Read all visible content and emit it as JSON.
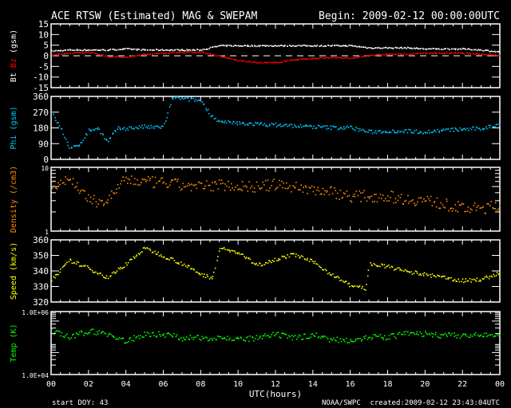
{
  "header": {
    "title": "ACE RTSW (Estimated) MAG & SWEPAM",
    "begin": "Begin: 2009-02-12 00:00:00UTC"
  },
  "footer": {
    "start_doy": "start DOY:  43",
    "agency": "NOAA/SWPC",
    "created": "created:2009-02-12 23:43:04UTC"
  },
  "colors": {
    "bt": "#ffffff",
    "bz": "#ff0000",
    "phi": "#00c8ff",
    "density": "#ff8c00",
    "speed": "#ffff00",
    "temp": "#00ff00",
    "axis": "#ffffff"
  },
  "chart_data": [
    {
      "type": "scatter",
      "name": "magnetic-field",
      "ylabel_parts": [
        "Bt",
        "Bz",
        "(gsm)"
      ],
      "ylim": [
        -15,
        15
      ],
      "yticks": [
        "15",
        "10",
        "5",
        "0",
        "-5",
        "-10",
        "-15"
      ],
      "ytick_values": [
        15,
        10,
        5,
        0,
        -5,
        -10,
        -15
      ],
      "dashed_zero": true,
      "x_hours": [
        0,
        1,
        2,
        3,
        4,
        5,
        6,
        7,
        8,
        9,
        10,
        11,
        12,
        13,
        14,
        15,
        16,
        17,
        18,
        19,
        20,
        21,
        22,
        23,
        24
      ],
      "series": [
        {
          "name": "Bt",
          "values": [
            2.5,
            3,
            3,
            3,
            3.5,
            3,
            3,
            3,
            3,
            5,
            5,
            5,
            5,
            5,
            5,
            5,
            5,
            4,
            4,
            4,
            3.5,
            3.5,
            3.5,
            3,
            2
          ]
        },
        {
          "name": "Bz",
          "values": [
            0.5,
            1.5,
            2,
            0,
            -0.5,
            1,
            1.5,
            2,
            2,
            0,
            -2,
            -3,
            -3,
            -1.5,
            -1,
            -0.5,
            -1,
            0.5,
            1,
            1,
            1.5,
            1.5,
            1.5,
            1,
            0.5
          ]
        }
      ]
    },
    {
      "type": "scatter",
      "name": "phi",
      "ylabel": "Phi (gsm)",
      "ylim": [
        0,
        360
      ],
      "yticks": [
        "360",
        "270",
        "180",
        "90",
        "0"
      ],
      "ytick_values": [
        360,
        270,
        180,
        90,
        0
      ],
      "x_hours": [
        0,
        0.5,
        1,
        1.5,
        2,
        2.5,
        3,
        3.5,
        4,
        4.5,
        5,
        5.5,
        6,
        6.5,
        7,
        7.5,
        8,
        8.5,
        9,
        10,
        11,
        12,
        13,
        14,
        15,
        16,
        17,
        18,
        19,
        20,
        21,
        22,
        23,
        24
      ],
      "series": [
        {
          "name": "Phi",
          "values": [
            270,
            180,
            60,
            90,
            170,
            180,
            100,
            180,
            180,
            185,
            190,
            185,
            190,
            360,
            350,
            345,
            340,
            260,
            215,
            210,
            205,
            200,
            195,
            190,
            185,
            185,
            160,
            165,
            165,
            160,
            170,
            175,
            180,
            205
          ]
        }
      ]
    },
    {
      "type": "scatter",
      "name": "density",
      "ylabel": "Density (/cm3)",
      "yscale": "log",
      "ylim": [
        1,
        10
      ],
      "yticks": [
        "10",
        "1"
      ],
      "ytick_values": [
        10,
        1
      ],
      "x_hours": [
        0,
        1,
        2,
        3,
        4,
        5,
        6,
        7,
        8,
        9,
        10,
        11,
        12,
        13,
        14,
        15,
        16,
        17,
        18,
        19,
        20,
        21,
        22,
        23,
        24
      ],
      "series": [
        {
          "name": "Density",
          "values": [
            5.5,
            6.5,
            3,
            3,
            6.5,
            6,
            5.8,
            5.3,
            5,
            5.5,
            5.2,
            5,
            5.5,
            5,
            4.6,
            4.2,
            3.6,
            3.6,
            3.6,
            3.2,
            3.1,
            2.7,
            2.3,
            2.3,
            2.6
          ]
        }
      ]
    },
    {
      "type": "scatter",
      "name": "speed",
      "ylabel": "Speed (km/s)",
      "ylim": [
        320,
        360
      ],
      "yticks": [
        "360",
        "350",
        "340",
        "330",
        "320"
      ],
      "ytick_values": [
        360,
        350,
        340,
        330,
        320
      ],
      "x_hours": [
        0,
        1,
        2,
        3,
        4,
        5,
        6,
        7,
        8,
        8.6,
        9,
        10,
        11,
        12,
        13,
        14,
        15,
        16,
        16.8,
        17,
        18,
        19,
        20,
        21,
        22,
        23,
        24
      ],
      "series": [
        {
          "name": "Speed",
          "values": [
            335,
            347,
            342,
            336,
            345,
            355,
            350,
            345,
            338,
            336,
            355,
            352,
            344,
            348,
            351,
            346,
            338,
            331,
            329,
            345,
            343,
            340,
            338,
            336,
            334,
            335,
            339
          ]
        }
      ]
    },
    {
      "type": "scatter",
      "name": "temperature",
      "ylabel": "Temp (K)",
      "yscale": "log",
      "ylim": [
        10000,
        1000000
      ],
      "yticks": [
        "1.0E+06",
        "1.0E+04"
      ],
      "ytick_values": [
        1000000,
        10000
      ],
      "x_hours": [
        0,
        1,
        2,
        3,
        4,
        5,
        6,
        7,
        8,
        9,
        10,
        11,
        12,
        13,
        14,
        15,
        16,
        17,
        18,
        19,
        20,
        21,
        22,
        23,
        24
      ],
      "series": [
        {
          "name": "Temp",
          "values": [
            250000,
            150000,
            250000,
            200000,
            110000,
            200000,
            200000,
            150000,
            150000,
            160000,
            130000,
            150000,
            190000,
            150000,
            190000,
            130000,
            130000,
            160000,
            160000,
            210000,
            200000,
            180000,
            180000,
            180000,
            180000
          ]
        }
      ]
    }
  ],
  "xaxis": {
    "label": "UTC(hours)",
    "ticks": [
      "00",
      "02",
      "04",
      "06",
      "08",
      "10",
      "12",
      "14",
      "16",
      "18",
      "20",
      "22",
      "00"
    ],
    "xlim": [
      0,
      24
    ]
  }
}
